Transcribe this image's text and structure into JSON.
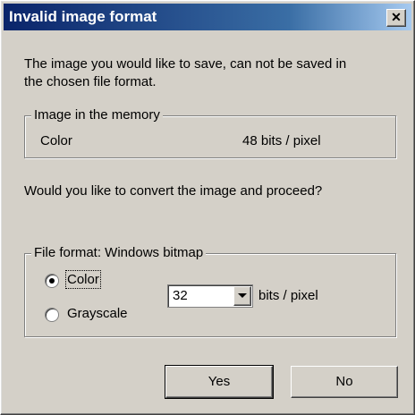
{
  "window": {
    "title": "Invalid image format"
  },
  "message": {
    "line1": "The image you would like to save, can not be saved in",
    "line2": "the chosen file format."
  },
  "memory_group": {
    "legend": "Image in the memory",
    "type": "Color",
    "depth": "48 bits / pixel"
  },
  "question": "Would you like to convert the image and proceed?",
  "format_group": {
    "legend": "File format: Windows bitmap",
    "options": [
      "Color",
      "Grayscale"
    ],
    "selected": "Color",
    "bits_value": "32",
    "bits_label": "bits / pixel"
  },
  "buttons": {
    "yes": "Yes",
    "no": "No"
  }
}
